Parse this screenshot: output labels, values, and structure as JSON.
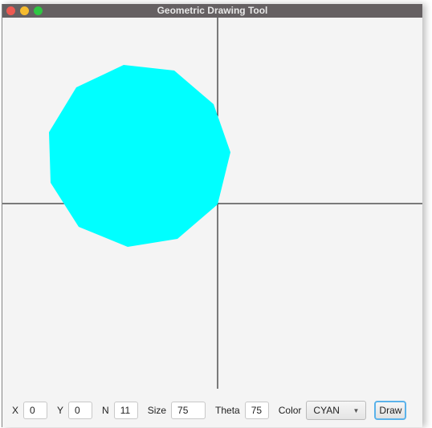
{
  "window": {
    "title": "Geometric Drawing Tool"
  },
  "shape": {
    "fill_color": "#00ffff",
    "sides": 11
  },
  "controls": {
    "x_label": "X",
    "x_value": "0",
    "y_label": "Y",
    "y_value": "0",
    "n_label": "N",
    "n_value": "11",
    "size_label": "Size",
    "size_value": "75",
    "theta_label": "Theta",
    "theta_value": "75",
    "color_label": "Color",
    "color_value": "CYAN",
    "draw_label": "Draw"
  }
}
